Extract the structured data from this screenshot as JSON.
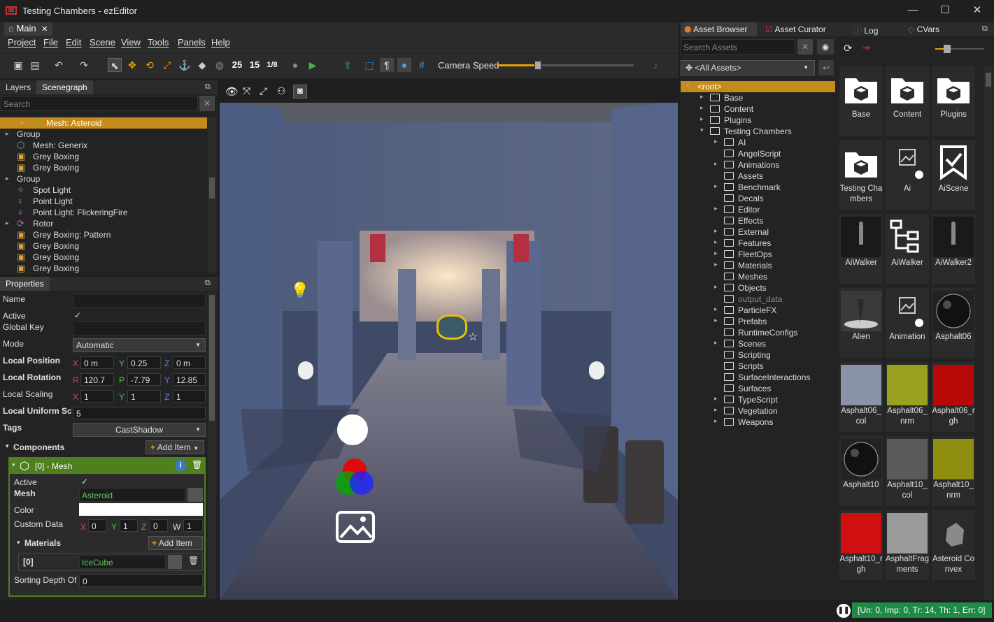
{
  "window": {
    "title": "Testing Chambers - ezEditor",
    "min": "—",
    "max": "☐",
    "close": "✕"
  },
  "doc_tab": {
    "label": "Main",
    "close": "✕"
  },
  "menu": [
    "Project",
    "File",
    "Edit",
    "Scene",
    "View",
    "Tools",
    "Panels",
    "Help"
  ],
  "toolbar": {
    "n25": "25",
    "n15": "15",
    "n18": "1/8",
    "camera_speed_label": "Camera Speed",
    "camera_speed_value": 0.3
  },
  "left_tabs": {
    "layers": "Layers",
    "scenegraph": "Scenegraph",
    "search_placeholder": "Search"
  },
  "scene_tree": [
    {
      "label": "Mesh: Asteroid",
      "indent": 1,
      "arrow": "▸",
      "icon": "mesh",
      "selected": true
    },
    {
      "label": "Group",
      "indent": 0,
      "arrow": "▸",
      "icon": "none"
    },
    {
      "label": "Mesh: Generix",
      "indent": 1,
      "arrow": "",
      "icon": "mesh"
    },
    {
      "label": "Grey Boxing",
      "indent": 1,
      "arrow": "",
      "icon": "box"
    },
    {
      "label": "Grey Boxing",
      "indent": 1,
      "arrow": "",
      "icon": "box"
    },
    {
      "label": "Group",
      "indent": 0,
      "arrow": "▸",
      "icon": "none"
    },
    {
      "label": "Spot Light",
      "indent": 1,
      "arrow": "",
      "icon": "spot"
    },
    {
      "label": "Point Light",
      "indent": 1,
      "arrow": "",
      "icon": "point"
    },
    {
      "label": "Point Light: FlickeringFire",
      "indent": 1,
      "arrow": "",
      "icon": "point"
    },
    {
      "label": "Rotor",
      "indent": 0,
      "arrow": "▸",
      "icon": "rotor"
    },
    {
      "label": "Grey Boxing: Pattern",
      "indent": 1,
      "arrow": "",
      "icon": "box"
    },
    {
      "label": "Grey Boxing",
      "indent": 1,
      "arrow": "",
      "icon": "box"
    },
    {
      "label": "Grey Boxing",
      "indent": 1,
      "arrow": "",
      "icon": "box"
    },
    {
      "label": "Grey Boxing",
      "indent": 1,
      "arrow": "",
      "icon": "box"
    }
  ],
  "properties": {
    "title": "Properties",
    "name_label": "Name",
    "active_label": "Active",
    "global_key_label": "Global Key",
    "mode_label": "Mode",
    "mode_value": "Automatic",
    "local_position_label": "Local Position",
    "local_rotation_label": "Local Rotation",
    "local_scaling_label": "Local Scaling",
    "local_uniform_label": "Local Uniform Sc",
    "tags_label": "Tags",
    "tags_value": "CastShadow",
    "pos": {
      "x": "0 m",
      "y": "0.25",
      "z": "0 m"
    },
    "rot": {
      "r": "120.7",
      "p": "-7.79",
      "y": "12.85"
    },
    "scale": {
      "x": "1",
      "y": "1",
      "z": "1"
    },
    "uniform": "5",
    "components_label": "Components",
    "add_item": "Add Item",
    "mesh_component": "[0] - Mesh",
    "c_active_label": "Active",
    "c_mesh_label": "Mesh",
    "c_mesh_value": "Asteroid",
    "c_color_label": "Color",
    "c_custom_label": "Custom Data",
    "c_custom": {
      "x": "0",
      "y": "1",
      "z": "0",
      "w": "1"
    },
    "materials_label": "Materials",
    "mat_index": "[0]",
    "mat_value": "IceCube",
    "sorting_label": "Sorting Depth Of",
    "sorting_value": "0",
    "axes": {
      "x": "X",
      "y": "Y",
      "z": "Z",
      "r": "R",
      "p": "P",
      "w": "W"
    }
  },
  "right_tabs": [
    "Asset Browser",
    "Asset Curator",
    "Log",
    "CVars"
  ],
  "asset_search_placeholder": "Search Assets",
  "all_assets": "<All Assets>",
  "folders": [
    {
      "label": "<root>",
      "indent": 0,
      "arrow": "▾",
      "root": true
    },
    {
      "label": "Base",
      "indent": 1,
      "arrow": "▸",
      "pkg": true
    },
    {
      "label": "Content",
      "indent": 1,
      "arrow": "▸",
      "pkg": true
    },
    {
      "label": "Plugins",
      "indent": 1,
      "arrow": "▸",
      "pkg": true
    },
    {
      "label": "Testing Chambers",
      "indent": 1,
      "arrow": "▾",
      "pkg": true
    },
    {
      "label": "AI",
      "indent": 2,
      "arrow": "▸"
    },
    {
      "label": "AngelScript",
      "indent": 2,
      "arrow": ""
    },
    {
      "label": "Animations",
      "indent": 2,
      "arrow": "▸"
    },
    {
      "label": "Assets",
      "indent": 2,
      "arrow": ""
    },
    {
      "label": "Benchmark",
      "indent": 2,
      "arrow": "▸"
    },
    {
      "label": "Decals",
      "indent": 2,
      "arrow": ""
    },
    {
      "label": "Editor",
      "indent": 2,
      "arrow": "▸"
    },
    {
      "label": "Effects",
      "indent": 2,
      "arrow": ""
    },
    {
      "label": "External",
      "indent": 2,
      "arrow": "▸"
    },
    {
      "label": "Features",
      "indent": 2,
      "arrow": "▸"
    },
    {
      "label": "FleetOps",
      "indent": 2,
      "arrow": "▸"
    },
    {
      "label": "Materials",
      "indent": 2,
      "arrow": "▸"
    },
    {
      "label": "Meshes",
      "indent": 2,
      "arrow": ""
    },
    {
      "label": "Objects",
      "indent": 2,
      "arrow": "▸"
    },
    {
      "label": "output_data",
      "indent": 2,
      "arrow": "",
      "dim": true
    },
    {
      "label": "ParticleFX",
      "indent": 2,
      "arrow": "▸"
    },
    {
      "label": "Prefabs",
      "indent": 2,
      "arrow": "▸"
    },
    {
      "label": "RuntimeConfigs",
      "indent": 2,
      "arrow": ""
    },
    {
      "label": "Scenes",
      "indent": 2,
      "arrow": "▸"
    },
    {
      "label": "Scripting",
      "indent": 2,
      "arrow": ""
    },
    {
      "label": "Scripts",
      "indent": 2,
      "arrow": ""
    },
    {
      "label": "SurfaceInteractions",
      "indent": 2,
      "arrow": ""
    },
    {
      "label": "Surfaces",
      "indent": 2,
      "arrow": ""
    },
    {
      "label": "TypeScript",
      "indent": 2,
      "arrow": "▸"
    },
    {
      "label": "Vegetation",
      "indent": 2,
      "arrow": "▸"
    },
    {
      "label": "Weapons",
      "indent": 2,
      "arrow": "▸"
    }
  ],
  "assets": [
    {
      "name": "Base",
      "kind": "folder",
      "bg": "none"
    },
    {
      "name": "Content",
      "kind": "folder",
      "bg": "none"
    },
    {
      "name": "Plugins",
      "kind": "folder",
      "bg": "none"
    },
    {
      "name": "Testing Chambers",
      "kind": "folder",
      "bg": "none"
    },
    {
      "name": "Ai",
      "kind": "ai",
      "bg": "#2b2b2b"
    },
    {
      "name": "AiScene",
      "kind": "scene",
      "bg": "#2b2b2b"
    },
    {
      "name": "AiWalker",
      "kind": "walker",
      "bg": "#1a1a1a"
    },
    {
      "name": "AiWalker",
      "kind": "graph",
      "bg": "#2b2b2b"
    },
    {
      "name": "AiWalker2",
      "kind": "walker2",
      "bg": "#1a1a1a"
    },
    {
      "name": "Alien",
      "kind": "alien",
      "bg": "#3a3a3a"
    },
    {
      "name": "Animation",
      "kind": "ai",
      "bg": "#2b2b2b"
    },
    {
      "name": "Asphalt06",
      "kind": "sphere",
      "bg": "#222"
    },
    {
      "name": "Asphalt06_col",
      "kind": "tex",
      "bg": "#8a93a6"
    },
    {
      "name": "Asphalt06_nrm",
      "kind": "tex",
      "bg": "#9aa020"
    },
    {
      "name": "Asphalt06_rgh",
      "kind": "tex",
      "bg": "#b80808"
    },
    {
      "name": "Asphalt10",
      "kind": "sphere",
      "bg": "#222"
    },
    {
      "name": "Asphalt10_col",
      "kind": "tex",
      "bg": "#5a5a5a"
    },
    {
      "name": "Asphalt10_nrm",
      "kind": "tex",
      "bg": "#8d8d10"
    },
    {
      "name": "Asphalt10_rgh",
      "kind": "tex",
      "bg": "#d01010"
    },
    {
      "name": "AsphaltFragments",
      "kind": "tex",
      "bg": "#9a9a9a"
    },
    {
      "name": "Asteroid Convex",
      "kind": "rock",
      "bg": "#2a2a2a"
    }
  ],
  "status": "[Un: 0, Imp: 0, Tr: 14, Th: 1, Err: 0]",
  "colors": {
    "accent": "#e8a000",
    "selection": "#c48a1a",
    "component_header": "#4f7f1f",
    "status_ok": "#1f8a45"
  }
}
